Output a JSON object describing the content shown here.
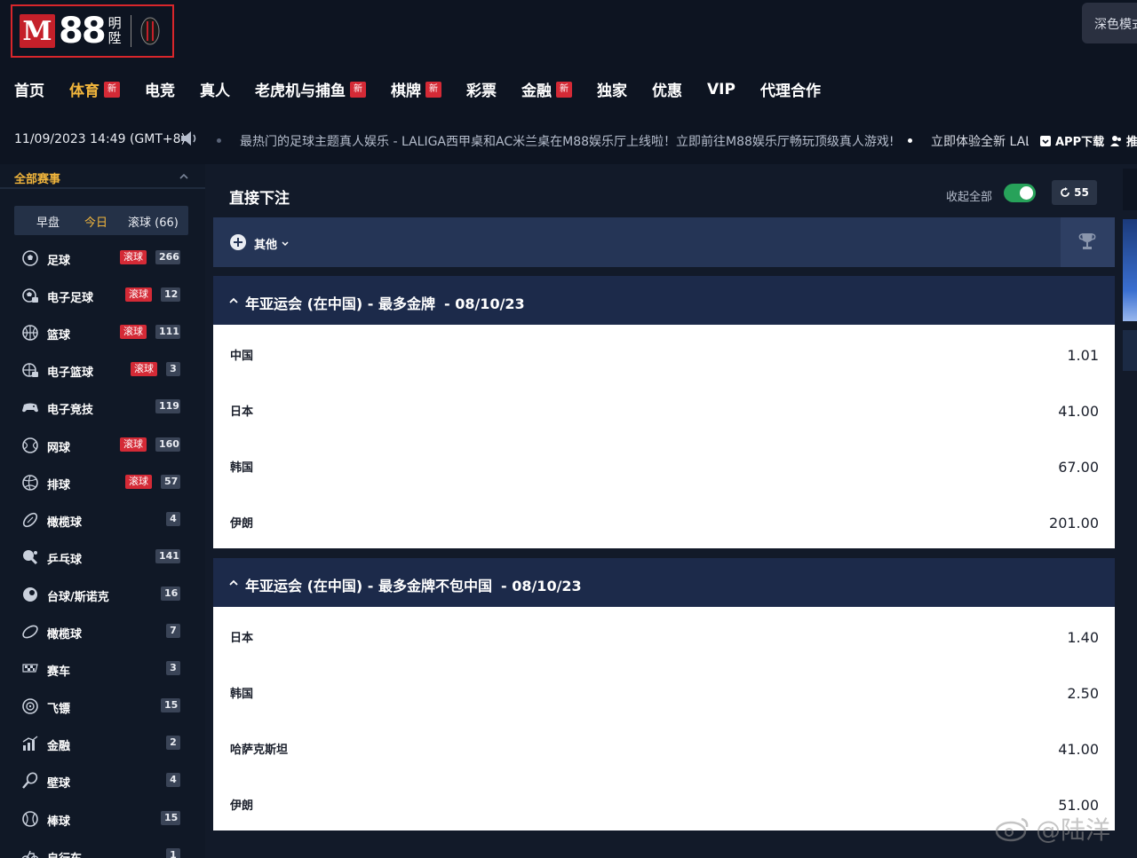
{
  "header": {
    "logo": {
      "mark": "M",
      "number": "88",
      "cn_line1": "明",
      "cn_line2": "陞"
    },
    "theme_button": "深色模式"
  },
  "nav": [
    {
      "label": "首页",
      "new": false,
      "active": false
    },
    {
      "label": "体育",
      "new": true,
      "active": true
    },
    {
      "label": "电竞",
      "new": false,
      "active": false
    },
    {
      "label": "真人",
      "new": false,
      "active": false
    },
    {
      "label": "老虎机与捕鱼",
      "new": true,
      "active": false
    },
    {
      "label": "棋牌",
      "new": true,
      "active": false
    },
    {
      "label": "彩票",
      "new": false,
      "active": false
    },
    {
      "label": "金融",
      "new": true,
      "active": false
    },
    {
      "label": "独家",
      "new": false,
      "active": false
    },
    {
      "label": "优惠",
      "new": false,
      "active": false
    },
    {
      "label": "VIP",
      "new": false,
      "active": false
    },
    {
      "label": "代理合作",
      "new": false,
      "active": false
    }
  ],
  "new_badge": "新",
  "infobar": {
    "datetime": "11/09/2023 14:49 (GMT+8)",
    "ticker": "最热门的足球主题真人娱乐 - LALIGA西甲桌和AC米兰桌在M88娱乐厅上线啦！立即前往M88娱乐厅畅玩顶级真人游戏!",
    "ticker2": "立即体验全新 LAL",
    "app_download": "APP下载",
    "promo": "推"
  },
  "sidebar": {
    "title": "全部赛事",
    "tabs": [
      {
        "label": "早盘",
        "active": false
      },
      {
        "label": "今日",
        "active": true
      },
      {
        "label": "滚球 (66)",
        "active": false
      }
    ],
    "live_label": "滚球",
    "items": [
      {
        "label": "足球",
        "icon": "soccer-icon",
        "live": true,
        "count": "266"
      },
      {
        "label": "电子足球",
        "icon": "esoccer-icon",
        "live": true,
        "count": "12"
      },
      {
        "label": "篮球",
        "icon": "basketball-icon",
        "live": true,
        "count": "111"
      },
      {
        "label": "电子篮球",
        "icon": "ebasketball-icon",
        "live": true,
        "count": "3"
      },
      {
        "label": "电子竞技",
        "icon": "gamepad-icon",
        "live": false,
        "count": "119"
      },
      {
        "label": "网球",
        "icon": "tennis-icon",
        "live": true,
        "count": "160"
      },
      {
        "label": "排球",
        "icon": "volleyball-icon",
        "live": true,
        "count": "57"
      },
      {
        "label": "橄榄球",
        "icon": "rugby-icon",
        "live": false,
        "count": "4"
      },
      {
        "label": "乒乓球",
        "icon": "table-tennis-icon",
        "live": false,
        "count": "141"
      },
      {
        "label": "台球/斯诺克",
        "icon": "snooker-icon",
        "live": false,
        "count": "16"
      },
      {
        "label": "橄榄球",
        "icon": "football-icon",
        "live": false,
        "count": "7"
      },
      {
        "label": "赛车",
        "icon": "racing-flag-icon",
        "live": false,
        "count": "3"
      },
      {
        "label": "飞镖",
        "icon": "darts-icon",
        "live": false,
        "count": "15"
      },
      {
        "label": "金融",
        "icon": "finance-icon",
        "live": false,
        "count": "2"
      },
      {
        "label": "壁球",
        "icon": "squash-icon",
        "live": false,
        "count": "4"
      },
      {
        "label": "棒球",
        "icon": "baseball-icon",
        "live": false,
        "count": "15"
      },
      {
        "label": "自行车",
        "icon": "bicycle-icon",
        "live": false,
        "count": "1"
      }
    ]
  },
  "panel": {
    "title": "直接下注",
    "collapse_all": "收起全部",
    "refresh_count": "55",
    "filter_label": "其他"
  },
  "sections": [
    {
      "title": "年亚运会 (在中国) - 最多金牌",
      "date": "- 08/10/23",
      "rows": [
        {
          "team": "中国",
          "odds": "1.01"
        },
        {
          "team": "日本",
          "odds": "41.00"
        },
        {
          "team": "韩国",
          "odds": "67.00"
        },
        {
          "team": "伊朗",
          "odds": "201.00"
        }
      ]
    },
    {
      "title": "年亚运会 (在中国) - 最多金牌不包中国",
      "date": "- 08/10/23",
      "rows": [
        {
          "team": "日本",
          "odds": "1.40"
        },
        {
          "team": "韩国",
          "odds": "2.50"
        },
        {
          "team": "哈萨克斯坦",
          "odds": "41.00"
        },
        {
          "team": "伊朗",
          "odds": "51.00"
        }
      ]
    }
  ],
  "watermark": "@陆洋",
  "colors": {
    "accent": "#f2b63c",
    "live_red": "#d42a36",
    "toggle_green": "#27a25a",
    "section_navy": "#1c2a4a"
  }
}
